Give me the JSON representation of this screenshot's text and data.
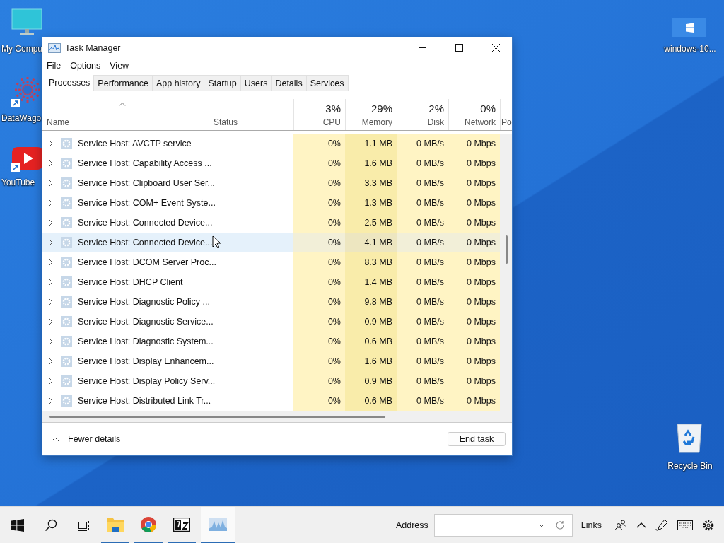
{
  "desktop": {
    "icons": [
      {
        "label": "My Compu",
        "kind": "computer",
        "shortcut": false
      },
      {
        "label": "DataWago",
        "kind": "datawagon",
        "shortcut": true
      },
      {
        "label": "YouTube",
        "kind": "youtube",
        "shortcut": true
      },
      {
        "label": "windows-10...",
        "kind": "windows",
        "shortcut": false
      },
      {
        "label": "Recycle Bin",
        "kind": "recycle",
        "shortcut": false
      }
    ]
  },
  "window": {
    "title": "Task Manager",
    "menu": [
      "File",
      "Options",
      "View"
    ],
    "tabs": [
      {
        "label": "Processes",
        "selected": true
      },
      {
        "label": "Performance",
        "selected": false
      },
      {
        "label": "App history",
        "selected": false
      },
      {
        "label": "Startup",
        "selected": false
      },
      {
        "label": "Users",
        "selected": false
      },
      {
        "label": "Details",
        "selected": false
      },
      {
        "label": "Services",
        "selected": false
      }
    ],
    "columns": [
      {
        "label": "Name"
      },
      {
        "label": "Status"
      },
      {
        "label": "CPU",
        "usage": "3%"
      },
      {
        "label": "Memory",
        "usage": "29%"
      },
      {
        "label": "Disk",
        "usage": "2%"
      },
      {
        "label": "Network",
        "usage": "0%"
      },
      {
        "label": "Po"
      }
    ],
    "rows": [
      {
        "name": "Service Host: AVCTP service",
        "cpu": "0%",
        "memory": "1.1 MB",
        "disk": "0 MB/s",
        "network": "0 Mbps",
        "highlighted": false
      },
      {
        "name": "Service Host: Capability Access ...",
        "cpu": "0%",
        "memory": "1.6 MB",
        "disk": "0 MB/s",
        "network": "0 Mbps",
        "highlighted": false
      },
      {
        "name": "Service Host: Clipboard User Ser...",
        "cpu": "0%",
        "memory": "3.3 MB",
        "disk": "0 MB/s",
        "network": "0 Mbps",
        "highlighted": false
      },
      {
        "name": "Service Host: COM+ Event Syste...",
        "cpu": "0%",
        "memory": "1.3 MB",
        "disk": "0 MB/s",
        "network": "0 Mbps",
        "highlighted": false
      },
      {
        "name": "Service Host: Connected Device...",
        "cpu": "0%",
        "memory": "2.5 MB",
        "disk": "0 MB/s",
        "network": "0 Mbps",
        "highlighted": false
      },
      {
        "name": "Service Host: Connected Device...",
        "cpu": "0%",
        "memory": "4.1 MB",
        "disk": "0 MB/s",
        "network": "0 Mbps",
        "highlighted": true
      },
      {
        "name": "Service Host: DCOM Server Proc...",
        "cpu": "0%",
        "memory": "8.3 MB",
        "disk": "0 MB/s",
        "network": "0 Mbps",
        "highlighted": false
      },
      {
        "name": "Service Host: DHCP Client",
        "cpu": "0%",
        "memory": "1.4 MB",
        "disk": "0 MB/s",
        "network": "0 Mbps",
        "highlighted": false
      },
      {
        "name": "Service Host: Diagnostic Policy ...",
        "cpu": "0%",
        "memory": "9.8 MB",
        "disk": "0 MB/s",
        "network": "0 Mbps",
        "highlighted": false
      },
      {
        "name": "Service Host: Diagnostic Service...",
        "cpu": "0%",
        "memory": "0.9 MB",
        "disk": "0 MB/s",
        "network": "0 Mbps",
        "highlighted": false
      },
      {
        "name": "Service Host: Diagnostic System...",
        "cpu": "0%",
        "memory": "0.6 MB",
        "disk": "0 MB/s",
        "network": "0 Mbps",
        "highlighted": false
      },
      {
        "name": "Service Host: Display Enhancem...",
        "cpu": "0%",
        "memory": "1.6 MB",
        "disk": "0 MB/s",
        "network": "0 Mbps",
        "highlighted": false
      },
      {
        "name": "Service Host: Display Policy Serv...",
        "cpu": "0%",
        "memory": "0.9 MB",
        "disk": "0 MB/s",
        "network": "0 Mbps",
        "highlighted": false
      },
      {
        "name": "Service Host: Distributed Link Tr...",
        "cpu": "0%",
        "memory": "0.6 MB",
        "disk": "0 MB/s",
        "network": "0 Mbps",
        "highlighted": false
      }
    ],
    "fewer_details": "Fewer details",
    "end_task": "End task"
  },
  "taskbar": {
    "apps": [
      {
        "kind": "explorer",
        "running": true,
        "focused": false
      },
      {
        "kind": "chrome",
        "running": true,
        "focused": false
      },
      {
        "kind": "archive",
        "running": true,
        "focused": false
      },
      {
        "kind": "taskmgr",
        "running": true,
        "focused": true
      }
    ],
    "address_label": "Address",
    "links_label": "Links"
  }
}
